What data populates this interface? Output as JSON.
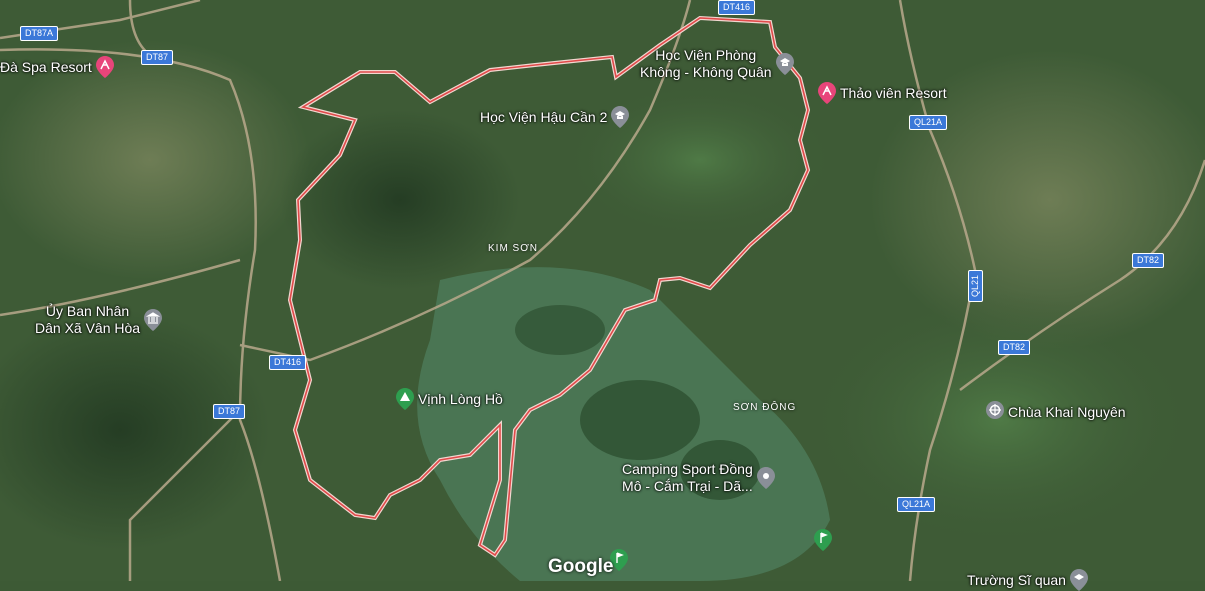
{
  "map": {
    "attribution": "Google",
    "region_outline_color": "#e04a4a",
    "background_color": "#3d5a35"
  },
  "places": [
    {
      "id": "kim-son",
      "label": "KIM SƠN"
    },
    {
      "id": "son-dong",
      "label": "SƠN ĐÔNG"
    }
  ],
  "pois": [
    {
      "id": "hoc-vien-phong-khong",
      "label_lines": [
        "Học Viện Phòng",
        "Không - Không Quân"
      ],
      "icon": "school-icon",
      "color": "#8a8f98"
    },
    {
      "id": "thao-vien-resort",
      "label_lines": [
        "Thảo viên Resort"
      ],
      "icon": "resort-icon",
      "color": "#e8457a"
    },
    {
      "id": "hoc-vien-hau-can",
      "label_lines": [
        "Học Viện Hậu Cần 2"
      ],
      "icon": "school-icon",
      "color": "#8a8f98"
    },
    {
      "id": "da-spa-resort",
      "label_lines": [
        "Đà Spa Resort"
      ],
      "icon": "resort-icon",
      "color": "#e8457a"
    },
    {
      "id": "uy-ban",
      "label_lines": [
        "Ủy Ban Nhân",
        "Dân Xã Vân Hòa"
      ],
      "icon": "government-icon",
      "color": "#8a8f98"
    },
    {
      "id": "vinh-long-ho",
      "label_lines": [
        "Vịnh Lòng Hồ"
      ],
      "icon": "park-icon",
      "color": "#2e9e4f"
    },
    {
      "id": "chua-khai-nguyen",
      "label_lines": [
        "Chùa Khai Nguyên"
      ],
      "icon": "temple-icon",
      "color": "#8a8f98"
    },
    {
      "id": "camping-sport",
      "label_lines": [
        "Camping Sport Đồng",
        "Mô - Cắm Trại - Dã..."
      ],
      "icon": "camping-icon",
      "color": "#8a8f98"
    },
    {
      "id": "truong-si-quan",
      "label_lines": [
        "Trường Sĩ quan"
      ],
      "icon": "school-icon",
      "color": "#8a8f98"
    },
    {
      "id": "golf-1",
      "label_lines": [],
      "icon": "golf-icon",
      "color": "#2e9e4f"
    },
    {
      "id": "golf-2",
      "label_lines": [],
      "icon": "golf-icon",
      "color": "#2e9e4f"
    }
  ],
  "road_shields": [
    {
      "id": "dt87a",
      "label": "DT87A"
    },
    {
      "id": "dt87-top",
      "label": "DT87"
    },
    {
      "id": "dt416-top",
      "label": "DT416"
    },
    {
      "id": "ql21a-top",
      "label": "QL21A"
    },
    {
      "id": "ql21",
      "label": "QL21"
    },
    {
      "id": "dt82-a",
      "label": "DT82"
    },
    {
      "id": "dt82-b",
      "label": "DT82"
    },
    {
      "id": "dt416-left",
      "label": "DT416"
    },
    {
      "id": "dt87-left",
      "label": "DT87"
    },
    {
      "id": "ql21a-bottom",
      "label": "QL21A"
    }
  ]
}
